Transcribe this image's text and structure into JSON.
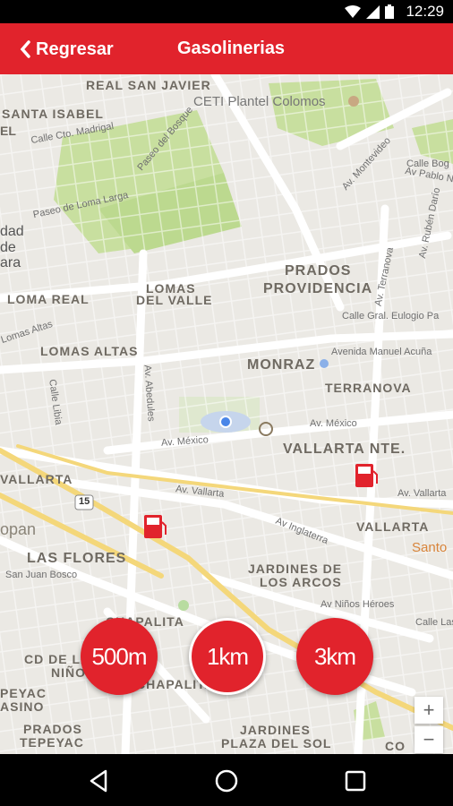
{
  "status": {
    "time": "12:29"
  },
  "appbar": {
    "back_label": "Regresar",
    "title": "Gasolinerias",
    "color": "#e1232c"
  },
  "map": {
    "areas": [
      "REAL SAN JAVIER",
      "SANTA ISABEL",
      "LOMA REAL",
      "LOMAS",
      "DEL VALLE",
      "LOMAS ALTAS",
      "PRADOS",
      "PROVIDENCIA",
      "MONRAZ",
      "TERRANOVA",
      "VALLARTA NTE.",
      "VALLARTA",
      "VALLARTA",
      "LAS FLORES",
      "JARDINES DE",
      "LOS ARCOS",
      "CHAPALITA",
      "CHAPALITA",
      "CD DE LA",
      "NIÑOS",
      "PEYAC",
      "ASINO",
      "PRADOS",
      "TEPEYAC",
      "JARDINES",
      "PLAZA DEL SOL",
      "CO"
    ],
    "streets": [
      "Calle Cto. Madrigal",
      "Paseo del Bosque",
      "Paseo de Loma Larga",
      "Lomas Altas",
      "Av. Montevideo",
      "Calle Bog",
      "Av Pablo Neru",
      "Av. Rubén Darío",
      "Av. Terranova",
      "Calle Gral. Eulogio Pa",
      "Avenida Manuel Acuña",
      "Av. México",
      "Av. México",
      "Av. Vallarta",
      "Av. Vallarta",
      "Av Inglaterra",
      "Av Niños Héroes",
      "Calle Libia",
      "Av. Abedules",
      "San Juan Bosco",
      "Calle Las"
    ],
    "pois": [
      "CETI Plantel Colomos",
      "Santo"
    ],
    "side_labels": [
      "dad",
      "de",
      "ara",
      "EL",
      "opan"
    ],
    "route_shield": "15"
  },
  "radius_buttons": [
    {
      "label": "500m"
    },
    {
      "label": "1km"
    },
    {
      "label": "3km"
    }
  ],
  "zoom": {
    "in": "+",
    "out": "−"
  },
  "icons": [
    "back-chevron-icon",
    "wifi-icon",
    "signal-icon",
    "battery-icon",
    "gas-station-icon",
    "location-dot-icon",
    "nav-back-icon",
    "nav-home-icon",
    "nav-recents-icon"
  ]
}
